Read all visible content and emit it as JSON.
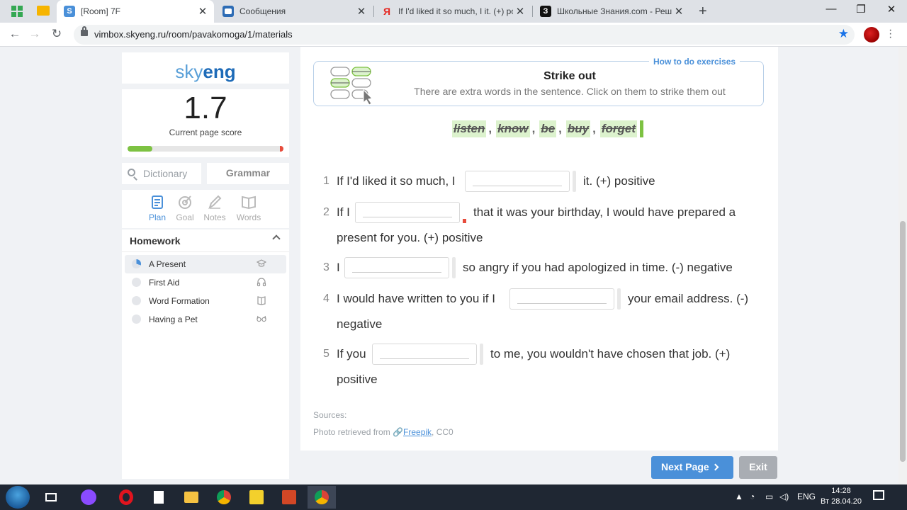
{
  "browser": {
    "tabs": [
      {
        "title": "[Room] 7F",
        "favicon": "S",
        "favicon_color": "#4a90d9",
        "active": true
      },
      {
        "title": "Сообщения",
        "favicon": "",
        "favicon_color": "#2d6cb5",
        "active": false
      },
      {
        "title": "If I'd liked it so much, I it. (+) pos",
        "favicon": "Я",
        "favicon_color": "#e52620",
        "active": false
      },
      {
        "title": "Школьные Знания.com - Решае",
        "favicon": "З",
        "favicon_color": "#111111",
        "active": false
      }
    ],
    "url": "vimbox.skyeng.ru/room/pavakomoga/1/materials"
  },
  "sidebar": {
    "logo_sky": "sky",
    "logo_eng": "eng",
    "score": "1.7",
    "score_label": "Current page score",
    "score_progress": 0.16,
    "dictionary_placeholder": "Dictionary",
    "grammar_label": "Grammar",
    "nav": [
      {
        "label": "Plan",
        "icon": "plan-icon",
        "active": true
      },
      {
        "label": "Goal",
        "icon": "goal-icon",
        "active": false
      },
      {
        "label": "Notes",
        "icon": "notes-icon",
        "active": false
      },
      {
        "label": "Words",
        "icon": "words-icon",
        "active": false
      }
    ],
    "homework_title": "Homework",
    "homework_items": [
      {
        "label": "A Present",
        "icon": "graduation-cap-icon",
        "active": true
      },
      {
        "label": "First Aid",
        "icon": "headphones-icon",
        "active": false
      },
      {
        "label": "Word Formation",
        "icon": "book-icon",
        "active": false
      },
      {
        "label": "Having a Pet",
        "icon": "glasses-icon",
        "active": false
      }
    ]
  },
  "exercise": {
    "how_to_link": "How to do exercises",
    "title": "Strike out",
    "instruction": "There are extra words in the sentence. Click on them to strike them out",
    "word_bank": [
      "listen",
      "know",
      "be",
      "buy",
      "forget"
    ],
    "items": [
      {
        "num": "1",
        "before": "If I'd liked it so much, I",
        "after": "it. (+) positive",
        "after2": ""
      },
      {
        "num": "2",
        "before": "If I",
        "after": "that it was your birthday, I would have prepared a",
        "after2": "present for you. (+) positive"
      },
      {
        "num": "3",
        "before": "I",
        "after": "so angry if you had apologized in time. (-) negative",
        "after2": ""
      },
      {
        "num": "4",
        "before": "I would have written to you if I",
        "after": "your email address. (-)",
        "after2": "negative"
      },
      {
        "num": "5",
        "before": "If you",
        "after": "to me, you wouldn't have chosen that job. (+)",
        "after2": "positive"
      }
    ],
    "sources_label": "Sources:",
    "credit_prefix": "Photo retrieved from ",
    "credit_link": "Freepik",
    "credit_suffix": ", CC0"
  },
  "footer": {
    "next_label": "Next Page",
    "exit_label": "Exit"
  },
  "taskbar": {
    "lang": "ENG",
    "time": "14:28",
    "date": "Вт 28.04.20"
  },
  "colors": {
    "accent": "#4a90d9",
    "progress": "#7dc242",
    "strike_bg": "#dcf2cd",
    "error": "#e74c3c"
  }
}
